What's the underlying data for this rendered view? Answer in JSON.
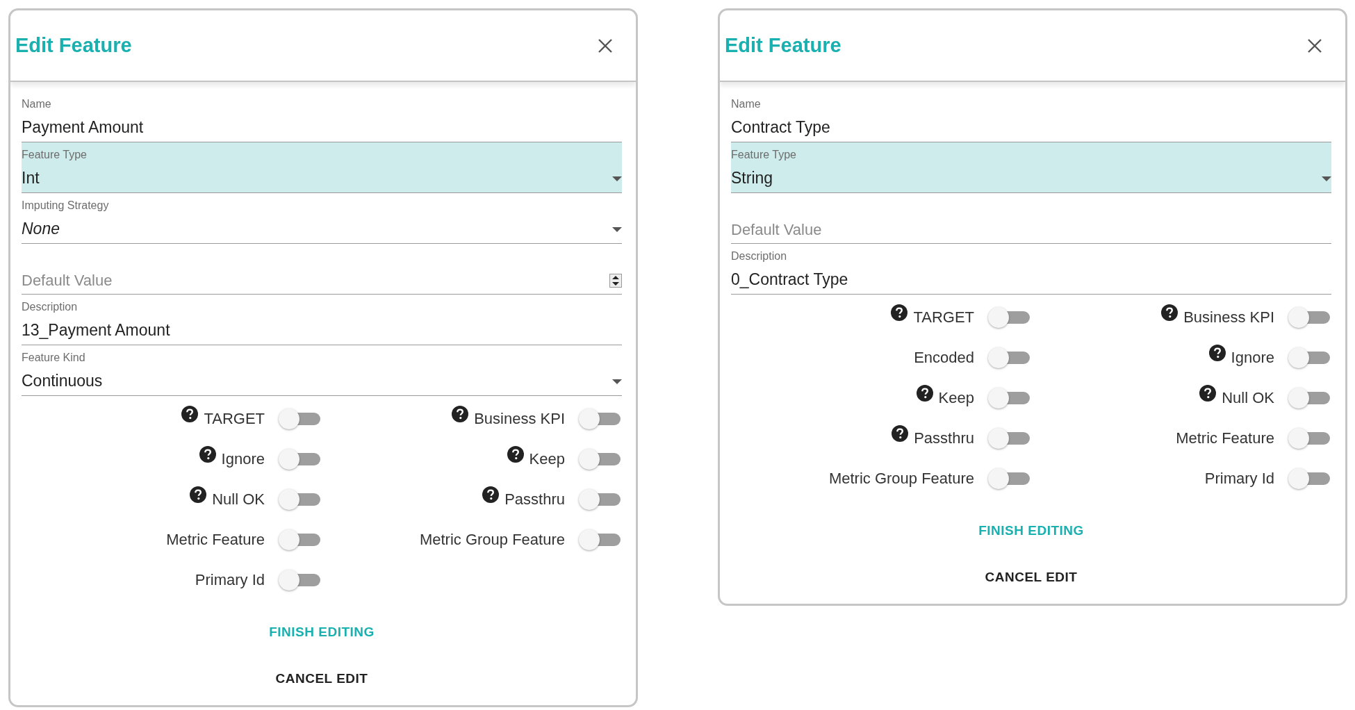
{
  "dialogs": [
    {
      "title": "Edit Feature",
      "fields": [
        {
          "kind": "text",
          "label": "Name",
          "value": "Payment Amount",
          "focused": false,
          "italic": false
        },
        {
          "kind": "select",
          "label": "Feature Type",
          "value": "Int",
          "focused": true,
          "italic": false
        },
        {
          "kind": "select",
          "label": "Imputing Strategy",
          "value": "None",
          "focused": false,
          "italic": true
        },
        {
          "kind": "number",
          "placeholder": "Default Value",
          "focused": false,
          "italic": false
        },
        {
          "kind": "text",
          "label": "Description",
          "value": "13_Payment Amount",
          "focused": false,
          "italic": false
        },
        {
          "kind": "select",
          "label": "Feature Kind",
          "value": "Continuous",
          "focused": false,
          "italic": false
        }
      ],
      "toggles": [
        {
          "label": "TARGET",
          "help": true,
          "on": false
        },
        {
          "label": "Business KPI",
          "help": true,
          "on": false
        },
        {
          "label": "Ignore",
          "help": true,
          "on": false
        },
        {
          "label": "Keep",
          "help": true,
          "on": false
        },
        {
          "label": "Null OK",
          "help": true,
          "on": false
        },
        {
          "label": "Passthru",
          "help": true,
          "on": false
        },
        {
          "label": "Metric Feature",
          "help": false,
          "on": false
        },
        {
          "label": "Metric Group Feature",
          "help": false,
          "on": false
        },
        {
          "label": "Primary Id",
          "help": false,
          "on": false
        }
      ],
      "buttons": [
        {
          "label": "FINISH EDITING",
          "kind": "primary"
        },
        {
          "label": "CANCEL EDIT",
          "kind": "secondary"
        }
      ]
    },
    {
      "title": "Edit Feature",
      "fields": [
        {
          "kind": "text",
          "label": "Name",
          "value": "Contract Type",
          "focused": false,
          "italic": false
        },
        {
          "kind": "select",
          "label": "Feature Type",
          "value": "String",
          "focused": true,
          "italic": false
        },
        {
          "kind": "text",
          "placeholder": "Default Value",
          "focused": false,
          "italic": false
        },
        {
          "kind": "text",
          "label": "Description",
          "value": "0_Contract Type",
          "focused": false,
          "italic": false
        }
      ],
      "toggles": [
        {
          "label": "TARGET",
          "help": true,
          "on": false
        },
        {
          "label": "Business KPI",
          "help": true,
          "on": false
        },
        {
          "label": "Encoded",
          "help": false,
          "on": false
        },
        {
          "label": "Ignore",
          "help": true,
          "on": false
        },
        {
          "label": "Keep",
          "help": true,
          "on": false
        },
        {
          "label": "Null OK",
          "help": true,
          "on": false
        },
        {
          "label": "Passthru",
          "help": true,
          "on": false
        },
        {
          "label": "Metric Feature",
          "help": false,
          "on": false
        },
        {
          "label": "Metric Group Feature",
          "help": false,
          "on": false
        },
        {
          "label": "Primary Id",
          "help": false,
          "on": false
        }
      ],
      "buttons": [
        {
          "label": "FINISH EDITING",
          "kind": "primary"
        },
        {
          "label": "CANCEL EDIT",
          "kind": "secondary"
        }
      ]
    }
  ]
}
